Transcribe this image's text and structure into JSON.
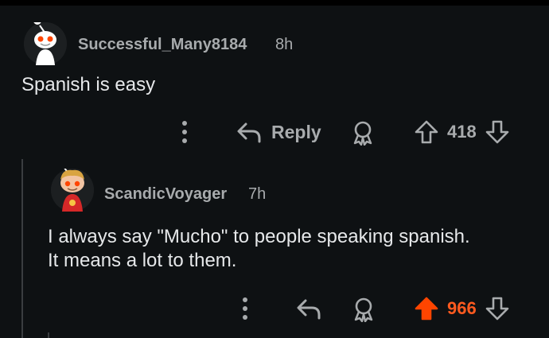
{
  "comments": [
    {
      "username": "Successful_Many8184",
      "age": "8h",
      "text_lines": [
        "Spanish is easy"
      ],
      "actions": {
        "reply_label": "Reply",
        "score": "418",
        "upvoted": false
      }
    },
    {
      "username": "ScandicVoyager",
      "age": "7h",
      "text_lines": [
        "I always say \"Mucho\" to people speaking spanish.",
        "It means a lot to them."
      ],
      "actions": {
        "score": "966",
        "upvoted": true
      }
    }
  ],
  "colors": {
    "background": "#0e1113",
    "text_muted": "#a8abad",
    "upvote_active": "#ff4500",
    "thread_line": "#3a3d40"
  },
  "icons": [
    "more-options-icon",
    "reply-icon",
    "award-icon",
    "upvote-icon",
    "downvote-icon"
  ]
}
